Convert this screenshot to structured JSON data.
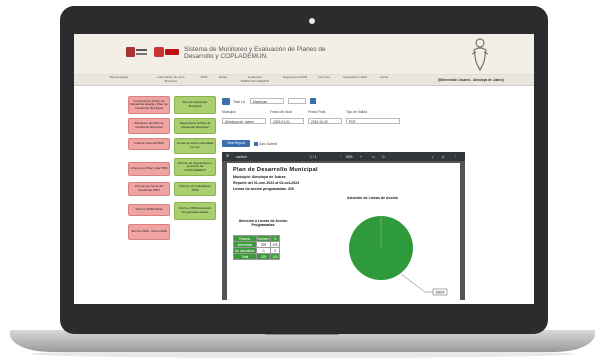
{
  "header": {
    "system_title": "Sistema de Monitoreo y Evaluación de Planes de Desarrollo y COPLADEMUN.",
    "logo1_text": "GOBIERNO DE MÉXICO",
    "logo2_text": "MÉXICO"
  },
  "nav": {
    "items": [
      "Bienvenida(o)",
      "Información de otros Municipio",
      "PDM",
      "Metas",
      "Evaluación PDM/COPLADEMUN",
      "Seguimiento PDM",
      "Informes",
      "Capitulación 2019",
      "Cerrar"
    ],
    "welcome": "(Bienvenido: Usuario - Almoloya de Juárez)"
  },
  "left_buttons": [
    {
      "label": "Componente al Plan de Desarrollo Estatal y Plan de Desarrollo Municipal",
      "color": "pink"
    },
    {
      "label": "Plan de Desarrollo Municipal",
      "color": "green"
    },
    {
      "label": "Alineación del Plan de Desarrollo Municipal",
      "color": "pink"
    },
    {
      "label": "Seguimiento al Plan de Desarrollo Municipal",
      "color": "green"
    },
    {
      "label": "Informe General PDM",
      "color": "pink"
    },
    {
      "label": "Líneas de acción atendidas por eje",
      "color": "green"
    },
    {
      "label": "Informe por Pilar y Eje PDM",
      "color": "pink"
    },
    {
      "label": "Informe de Seguimiento a acuerdos de COPLADEMUN",
      "color": "green"
    },
    {
      "label": "Informe por Tema del Desarrollo PDM",
      "color": "pink"
    },
    {
      "label": "Informe por Indicadores PDM",
      "color": "green"
    },
    {
      "label": "Informe PDM-Metas",
      "color": "pink"
    },
    {
      "label": "Informe PDM Estructura Programática-Metas",
      "color": "green"
    },
    {
      "label": "Informe PDM - Anexo 2022",
      "color": "pink"
    }
  ],
  "controls": {
    "total_label": "Total Lvl",
    "zoom_value": "Maximum",
    "municipio_label": "Municipio",
    "municipio_value": "Almoloya de Juárez",
    "fecha_inicio_label": "Fecha de Inicio",
    "fecha_inicio_value": "2022-01-01",
    "fecha_final_label": "Fecha Final",
    "fecha_final_value": "2024-10-02",
    "tipo_label": "Tipo de Salida",
    "tipo_value": "PDF",
    "view_report": "View Report",
    "auto_submit": "Auto Submit"
  },
  "pdf": {
    "doc_name": "content",
    "page": "1 / 1",
    "zoom": "83%",
    "title": "Plan de Desarrollo Municipal",
    "municipio_line": "Municipio:  Almoloya de Juárez",
    "reporte_line": "Reporte del 01-ene-2022 al 02-oct-2024",
    "lineas_line": "Líneas de acción programadas: 329",
    "chart_title": "Atención de Líneas de Acción",
    "table_title": "Atención a Líneas de Acción Programadas",
    "table_headers": [
      "Estatus",
      "Número",
      "%"
    ],
    "table_rows": [
      [
        "Atendidas",
        "329",
        "100"
      ],
      [
        "No Atendidas",
        "0",
        "0"
      ],
      [
        "Total",
        "329",
        "100"
      ]
    ]
  },
  "chart_data": {
    "type": "pie",
    "title": "Atención de Líneas de Acción",
    "categories": [
      "Atendidas",
      "No Atendidas"
    ],
    "values": [
      100,
      0
    ],
    "data_labels": [
      "100%"
    ],
    "colors": [
      "#2f9a3a",
      "#cccccc"
    ]
  }
}
